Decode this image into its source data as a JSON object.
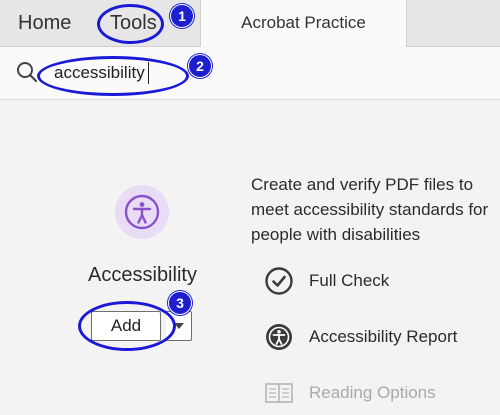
{
  "tabs": {
    "home": "Home",
    "tools": "Tools",
    "document": "Acrobat Practice"
  },
  "search": {
    "value": "accessibility",
    "icon": "search-icon"
  },
  "tool": {
    "icon": "accessibility-icon",
    "name": "Accessibility",
    "add_label": "Add",
    "accent_color": "#8a52c7",
    "description": "Create and verify PDF files to meet accessibility standards for people with disabilities"
  },
  "features": [
    {
      "label": "Full Check",
      "icon": "checkmark-circle-icon",
      "enabled": true
    },
    {
      "label": "Accessibility Report",
      "icon": "accessibility-report-icon",
      "enabled": true
    },
    {
      "label": "Reading Options",
      "icon": "book-icon",
      "enabled": false
    }
  ],
  "callouts": [
    "1",
    "2",
    "3"
  ],
  "callout_color": "#1a1ad6"
}
